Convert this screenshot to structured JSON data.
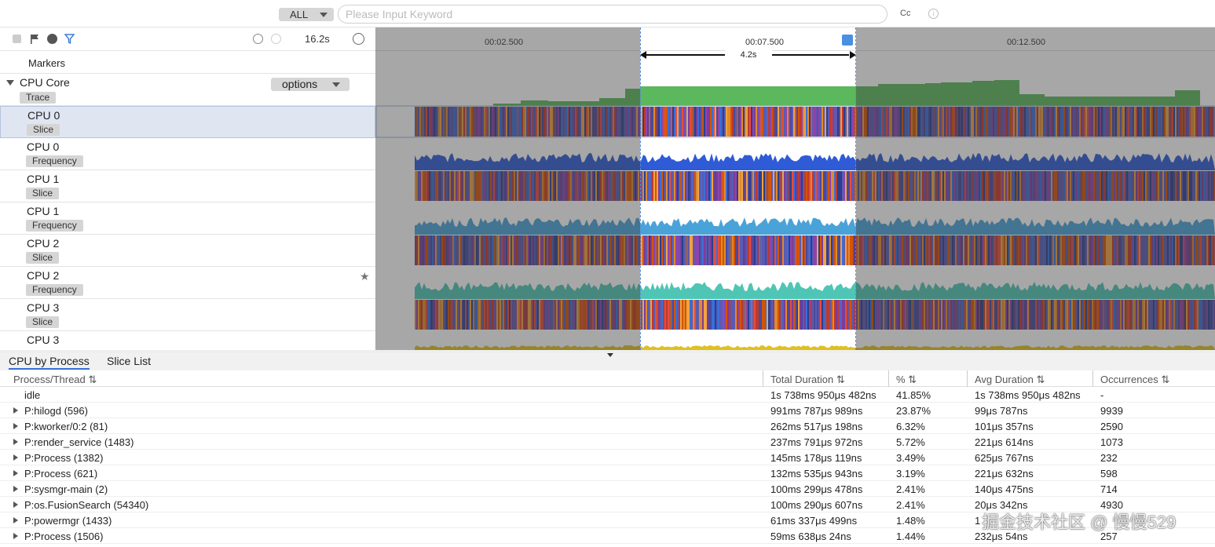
{
  "topbar": {
    "scope": "ALL",
    "search_placeholder": "Please Input Keyword",
    "cc_label": "Cc"
  },
  "toolbar": {
    "duration": "16.2s"
  },
  "timeline": {
    "ticks": [
      "00:02.500",
      "00:07.500",
      "00:12.500"
    ],
    "selection_label": "4.2s"
  },
  "tracks": {
    "markers": "Markers",
    "cpu_core": {
      "name": "CPU Core",
      "badge": "Trace",
      "options": "options"
    },
    "rows": [
      {
        "name": "CPU 0",
        "badge": "Slice"
      },
      {
        "name": "CPU 0",
        "badge": "Frequency"
      },
      {
        "name": "CPU 1",
        "badge": "Slice"
      },
      {
        "name": "CPU 1",
        "badge": "Frequency"
      },
      {
        "name": "CPU 2",
        "badge": "Slice"
      },
      {
        "name": "CPU 2",
        "badge": "Frequency"
      },
      {
        "name": "CPU 3",
        "badge": "Slice"
      },
      {
        "name": "CPU 3",
        "badge": ""
      }
    ]
  },
  "colors": {
    "trace_green": "#5cb85c",
    "freq0": "#2f5bd6",
    "freq1": "#4aa3d8",
    "freq2": "#4fc5b5",
    "freq3": "#e0c020",
    "tab_active": "#3a6fd8"
  },
  "bottom": {
    "tabs": [
      "CPU by Process",
      "Slice List"
    ],
    "columns": [
      "Process/Thread",
      "Total Duration",
      "%",
      "Avg Duration",
      "Occurrences"
    ],
    "rows": [
      {
        "name": "idle",
        "expand": false,
        "total": "1s 738ms 950μs 482ns",
        "pct": "41.85%",
        "avg": "1s 738ms 950μs 482ns",
        "occ": "-"
      },
      {
        "name": "P:hilogd (596)",
        "expand": true,
        "total": "991ms 787μs 989ns",
        "pct": "23.87%",
        "avg": "99μs 787ns",
        "occ": "9939"
      },
      {
        "name": "P:kworker/0:2 (81)",
        "expand": true,
        "total": "262ms 517μs 198ns",
        "pct": "6.32%",
        "avg": "101μs 357ns",
        "occ": "2590"
      },
      {
        "name": "P:render_service (1483)",
        "expand": true,
        "total": "237ms 791μs 972ns",
        "pct": "5.72%",
        "avg": "221μs 614ns",
        "occ": "1073"
      },
      {
        "name": "P:Process (1382)",
        "expand": true,
        "total": "145ms 178μs 119ns",
        "pct": "3.49%",
        "avg": "625μs 767ns",
        "occ": "232"
      },
      {
        "name": "P:Process (621)",
        "expand": true,
        "total": "132ms 535μs 943ns",
        "pct": "3.19%",
        "avg": "221μs 632ns",
        "occ": "598"
      },
      {
        "name": "P:sysmgr-main (2)",
        "expand": true,
        "total": "100ms 299μs 478ns",
        "pct": "2.41%",
        "avg": "140μs 475ns",
        "occ": "714"
      },
      {
        "name": "P:os.FusionSearch (54340)",
        "expand": true,
        "total": "100ms 290μs 607ns",
        "pct": "2.41%",
        "avg": "20μs 342ns",
        "occ": "4930"
      },
      {
        "name": "P:powermgr (1433)",
        "expand": true,
        "total": "61ms 337μs 499ns",
        "pct": "1.48%",
        "avg": "1",
        "occ": ""
      },
      {
        "name": "P:Process (1506)",
        "expand": true,
        "total": "59ms 638μs 24ns",
        "pct": "1.44%",
        "avg": "232μs 54ns",
        "occ": "257"
      }
    ]
  },
  "watermark": "掘金技术社区 @ 慢慢529"
}
